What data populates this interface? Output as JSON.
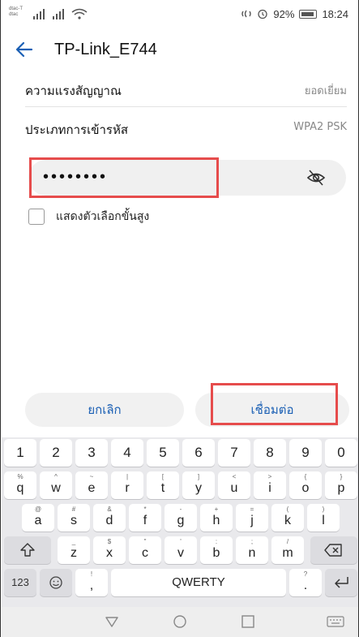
{
  "status_bar": {
    "carrier_line1": "dtac-T",
    "carrier_line2": "dtac",
    "battery_percent": "92%",
    "time": "18:24"
  },
  "header": {
    "title": "TP-Link_E744",
    "back_icon": "arrow-left-icon"
  },
  "signal_row": {
    "label": "ความแรงสัญญาณ",
    "value": "ยอดเยี่ยม"
  },
  "security_row": {
    "label": "ประเภทการเข้ารหัส",
    "value": "WPA2 PSK"
  },
  "password": {
    "masked_value": "••••••••",
    "toggle_icon": "eye-hidden-icon"
  },
  "advanced": {
    "label": "แสดงตัวเลือกขั้นสูง",
    "checked": false
  },
  "actions": {
    "cancel_label": "ยกเลิก",
    "connect_label": "เชื่อมต่อ"
  },
  "keyboard": {
    "number_row": [
      "1",
      "2",
      "3",
      "4",
      "5",
      "6",
      "7",
      "8",
      "9",
      "0"
    ],
    "row1": [
      {
        "hint": "%",
        "key": "q"
      },
      {
        "hint": "^",
        "key": "w"
      },
      {
        "hint": "~",
        "key": "e"
      },
      {
        "hint": "|",
        "key": "r"
      },
      {
        "hint": "[",
        "key": "t"
      },
      {
        "hint": "]",
        "key": "y"
      },
      {
        "hint": "<",
        "key": "u"
      },
      {
        "hint": ">",
        "key": "i"
      },
      {
        "hint": "{",
        "key": "o"
      },
      {
        "hint": "}",
        "key": "p"
      }
    ],
    "row2": [
      {
        "hint": "@",
        "key": "a"
      },
      {
        "hint": "#",
        "key": "s"
      },
      {
        "hint": "&",
        "key": "d"
      },
      {
        "hint": "*",
        "key": "f"
      },
      {
        "hint": "-",
        "key": "g"
      },
      {
        "hint": "+",
        "key": "h"
      },
      {
        "hint": "=",
        "key": "j"
      },
      {
        "hint": "(",
        "key": "k"
      },
      {
        "hint": ")",
        "key": "l"
      }
    ],
    "row3": [
      {
        "hint": "_",
        "key": "z"
      },
      {
        "hint": "$",
        "key": "x"
      },
      {
        "hint": "\"",
        "key": "c"
      },
      {
        "hint": "'",
        "key": "v"
      },
      {
        "hint": ":",
        "key": "b"
      },
      {
        "hint": ";",
        "key": "n"
      },
      {
        "hint": "/",
        "key": "m"
      }
    ],
    "shift_icon": "shift-icon",
    "backspace_icon": "backspace-icon",
    "symbols_label": "123",
    "emoji_icon": "emoji-icon",
    "comma_hint": "!",
    "comma_key": ",",
    "space_label": "QWERTY",
    "period_hint": "?",
    "period_key": ".",
    "enter_icon": "enter-icon"
  },
  "nav_bar": {
    "back_icon": "nav-back-icon",
    "home_icon": "nav-home-icon",
    "recents_icon": "nav-recents-icon",
    "keyboard_icon": "keyboard-icon"
  },
  "colors": {
    "accent": "#1a5fb4",
    "highlight": "#e64c4c",
    "keyboard_bg": "#e9e9ec"
  }
}
